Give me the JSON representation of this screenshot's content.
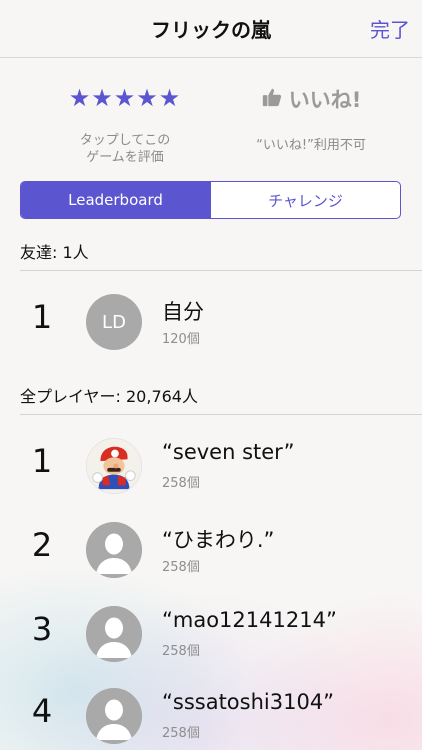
{
  "nav": {
    "title": "フリックの嵐",
    "done_label": "完了"
  },
  "rating": {
    "stars": "★★★★★",
    "stars_caption_1": "タップしてこの",
    "stars_caption_2": "ゲームを評価",
    "like_label": "いいね!",
    "like_caption": "“いいね!”利用不可",
    "accent_color": "#5b55cf"
  },
  "tabs": {
    "leaderboard": "Leaderboard",
    "challenge": "チャレンジ"
  },
  "friends": {
    "header": "友達: 1人",
    "rows": [
      {
        "rank": "1",
        "initials": "LD",
        "name": "自分",
        "score": "120個"
      }
    ]
  },
  "all_players": {
    "header": "全プレイヤー: 20,764人",
    "rows": [
      {
        "rank": "1",
        "name": "“seven ster”",
        "score": "258個",
        "avatar": "mario-avatar"
      },
      {
        "rank": "2",
        "name": "“ひまわり.”",
        "score": "258個",
        "avatar": "default-avatar"
      },
      {
        "rank": "3",
        "name": "“mao12141214”",
        "score": "258個",
        "avatar": "default-avatar"
      },
      {
        "rank": "4",
        "name": "“sssatoshi3104”",
        "score": "258個",
        "avatar": "default-avatar"
      }
    ]
  }
}
